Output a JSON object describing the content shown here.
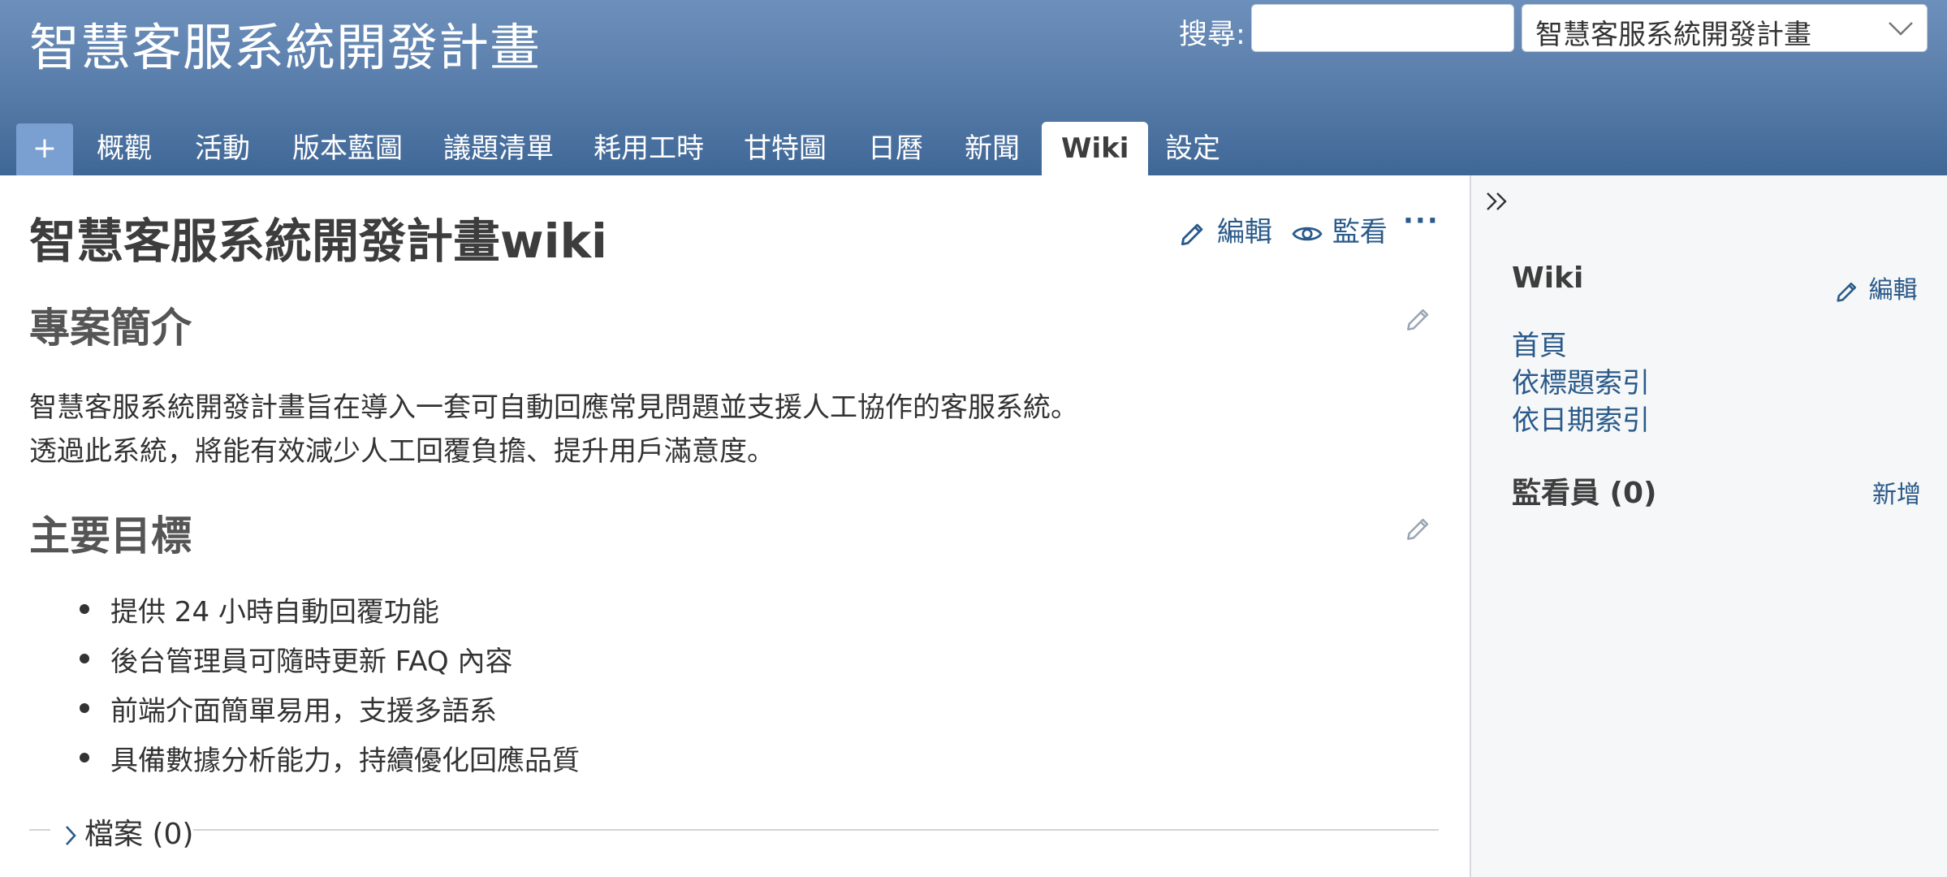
{
  "header": {
    "project_title": "智慧客服系統開發計畫",
    "search_label": "搜尋:",
    "search_value": "",
    "search_placeholder": "",
    "project_select_value": "智慧客服系統開發計畫"
  },
  "tabs": {
    "new_label": "+",
    "items": [
      "概觀",
      "活動",
      "版本藍圖",
      "議題清單",
      "耗用工時",
      "甘特圖",
      "日曆",
      "新聞",
      "Wiki",
      "設定"
    ],
    "selected": "Wiki"
  },
  "page": {
    "title": "智慧客服系統開發計畫wiki",
    "actions": {
      "edit": "編輯",
      "watch": "監看",
      "more": "···"
    },
    "sections": [
      {
        "heading": "專案簡介",
        "paragraphs": [
          "智慧客服系統開發計畫旨在導入一套可自動回應常見問題並支援人工協作的客服系統。",
          "透過此系統，將能有效減少人工回覆負擔、提升用戶滿意度。"
        ]
      },
      {
        "heading": "主要目標",
        "items": [
          "提供 24 小時自動回覆功能",
          "後台管理員可隨時更新 FAQ 內容",
          "前端介面簡單易用，支援多語系",
          "具備數據分析能力，持續優化回應品質"
        ]
      }
    ],
    "files_label": "檔案 (0)"
  },
  "sidebar": {
    "wiki_title": "Wiki",
    "edit_label": "編輯",
    "links": [
      "首頁",
      "依標題索引",
      "依日期索引"
    ],
    "watchers_title": "監看員 (0)",
    "watchers_add": "新增"
  },
  "colors": {
    "header_top": "#6d8fbb",
    "header_bottom": "#3f6796",
    "link": "#2a5a8a",
    "sidebar_bg": "#f6f7f8"
  },
  "icons": [
    "pencil-icon",
    "eye-icon",
    "chevron-down-icon",
    "chevron-right-icon",
    "double-chevron-right-icon"
  ]
}
